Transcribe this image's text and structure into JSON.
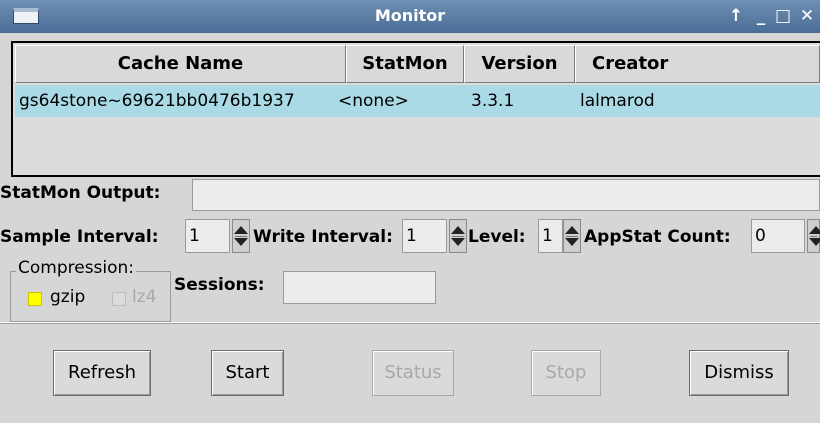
{
  "window": {
    "title": "Monitor",
    "controls": {
      "pin": "↑",
      "minimize": "_",
      "maximize": "□",
      "close": "✕"
    }
  },
  "table": {
    "columns": [
      "Cache Name",
      "StatMon",
      "Version",
      "Creator"
    ],
    "rows": [
      {
        "cache_name": "gs64stone~69621bb0476b1937",
        "statmon": "<none>",
        "version": "3.3.1",
        "creator": "lalmarod"
      }
    ],
    "selected_row_color": "#a9dae5"
  },
  "form": {
    "statmon_output_label": "StatMon Output:",
    "statmon_output_value": "",
    "sample_interval_label": "Sample Interval:",
    "sample_interval_value": "1",
    "write_interval_label": "Write Interval:",
    "write_interval_value": "1",
    "level_label": "Level:",
    "level_value": "1",
    "appstat_count_label": "AppStat Count:",
    "appstat_count_value": "0",
    "compression_label": "Compression:",
    "gzip_label": "gzip",
    "gzip_checked": true,
    "lz4_label": "lz4",
    "lz4_checked": false,
    "sessions_label": "Sessions:",
    "sessions_value": ""
  },
  "buttons": {
    "refresh": "Refresh",
    "start": "Start",
    "status": "Status",
    "stop": "Stop",
    "dismiss": "Dismiss"
  }
}
